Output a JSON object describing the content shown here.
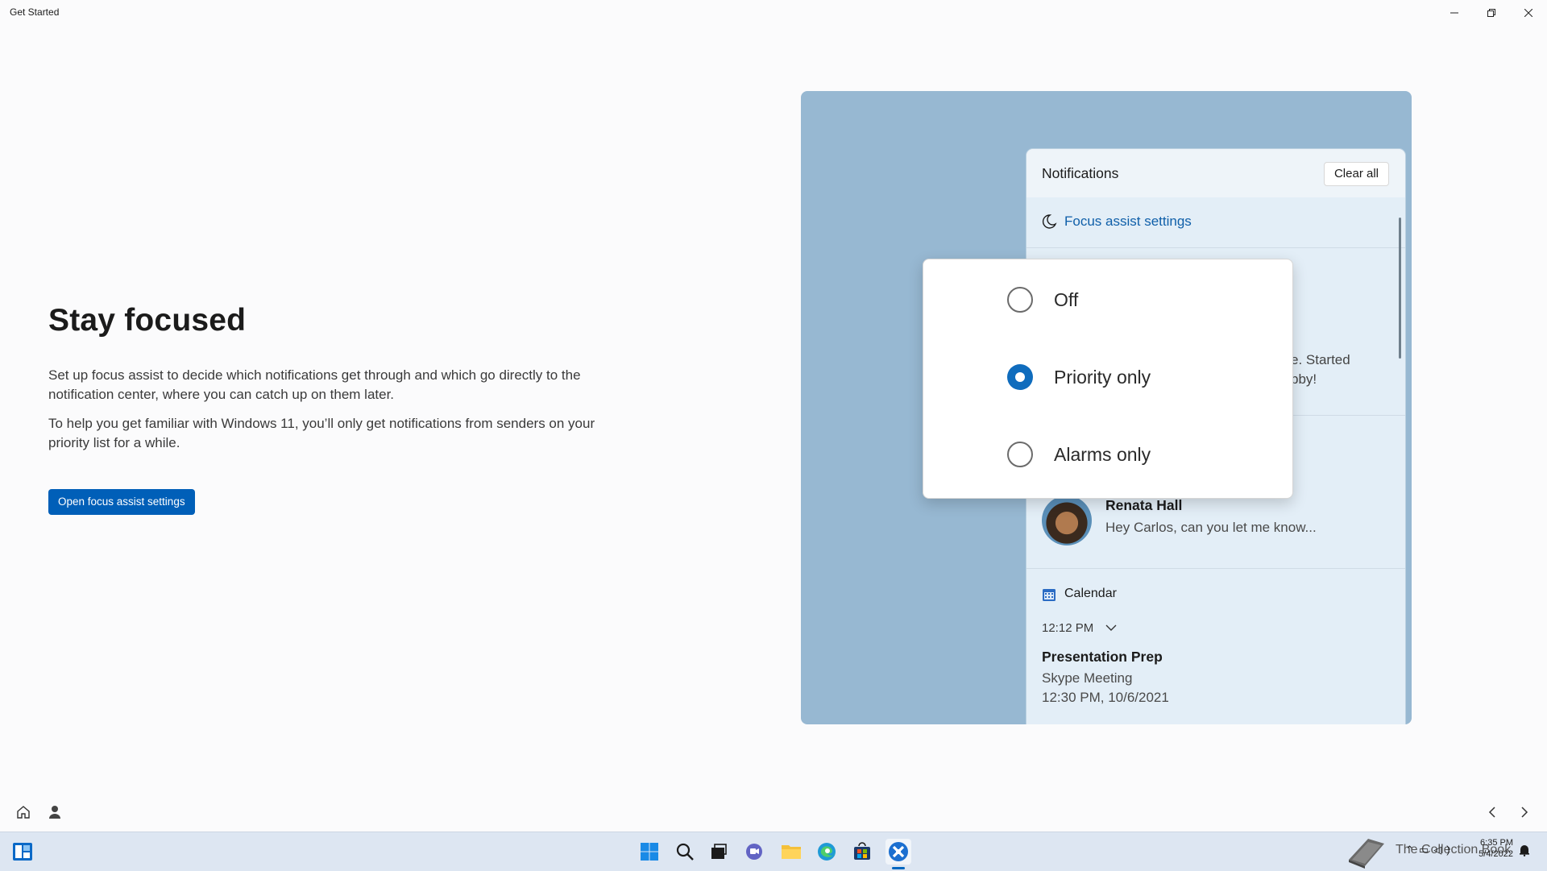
{
  "window": {
    "title": "Get Started"
  },
  "main": {
    "heading": "Stay focused",
    "paragraph1": "Set up focus assist to decide which notifications get through and which go directly to the notification center, where you can catch up on them later.",
    "paragraph2": "To help you get familiar with Windows 11, you’ll only get notifications from senders on your priority list for a while.",
    "button_label": "Open focus assist settings"
  },
  "illustration": {
    "notifications_title": "Notifications",
    "clear_all_label": "Clear all",
    "focus_assist_label": "Focus assist settings",
    "partial_line1": "e. Started",
    "partial_line2": "bby!",
    "radio_options": [
      {
        "label": "Off",
        "selected": false
      },
      {
        "label": "Priority only",
        "selected": true
      },
      {
        "label": "Alarms only",
        "selected": false
      }
    ],
    "message": {
      "sender": "Renata Hall",
      "preview": "Hey Carlos, can you let me know..."
    },
    "calendar": {
      "app_label": "Calendar",
      "time": "12:12 PM",
      "event_title": "Presentation Prep",
      "event_subtitle": "Skype Meeting",
      "event_datetime": "12:30 PM, 10/6/2021"
    }
  },
  "taskbar": {
    "icons": [
      "widgets-icon",
      "start-icon",
      "search-icon",
      "task-view-icon",
      "chat-icon",
      "file-explorer-icon",
      "edge-icon",
      "store-icon",
      "get-started-icon"
    ],
    "tray_text": "The Collection Book",
    "clock_time": "6:35 PM",
    "clock_date": "5/4/2022"
  },
  "colors": {
    "accent": "#005fb8",
    "illustration_bg": "#97b8d2",
    "panel_bg": "#e3eef7",
    "radio_selected": "#0f6cbd"
  }
}
